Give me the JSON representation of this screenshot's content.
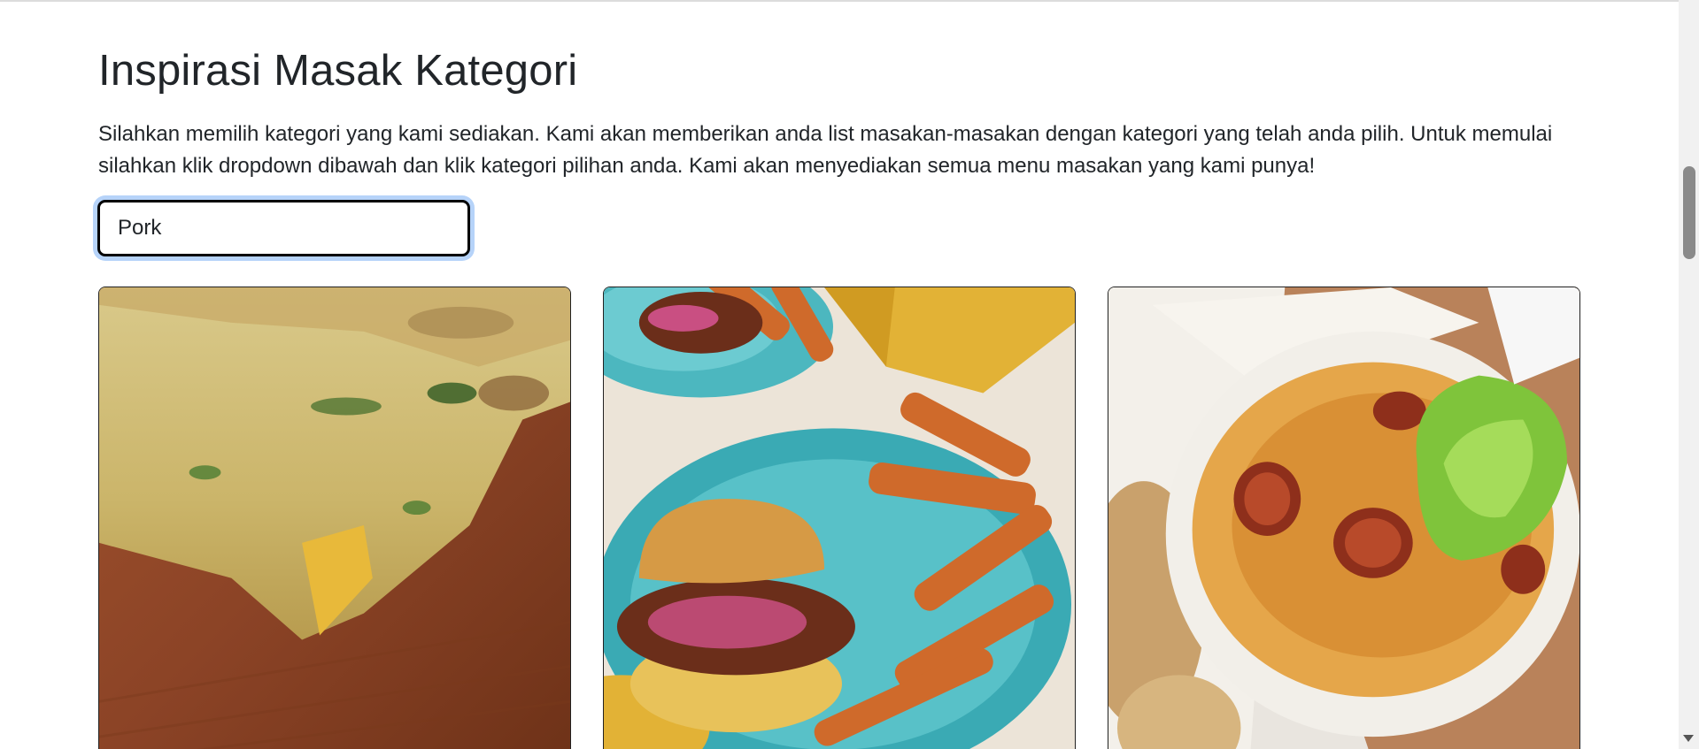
{
  "page": {
    "title": "Inspirasi Masak Kategori",
    "description": "Silahkan memilih kategori yang kami sediakan. Kami akan memberikan anda list masakan-masakan dengan kategori yang telah anda pilih. Untuk memulai silahkan klik dropdown dibawah dan klik kategori pilihan anda. Kami akan menyediakan semua menu masakan yang kami punya!"
  },
  "category_select": {
    "selected_value": "Pork"
  },
  "cards": [
    {
      "image": "pork-frittata-slice-photo"
    },
    {
      "image": "sloppy-joe-burger-with-sweet-potato-fries-photo"
    },
    {
      "image": "sauerkraut-with-sausage-bowl-photo"
    }
  ],
  "colors": {
    "focus_ring": "#b6d3f9",
    "text": "#212529",
    "card_border": "#222222"
  }
}
